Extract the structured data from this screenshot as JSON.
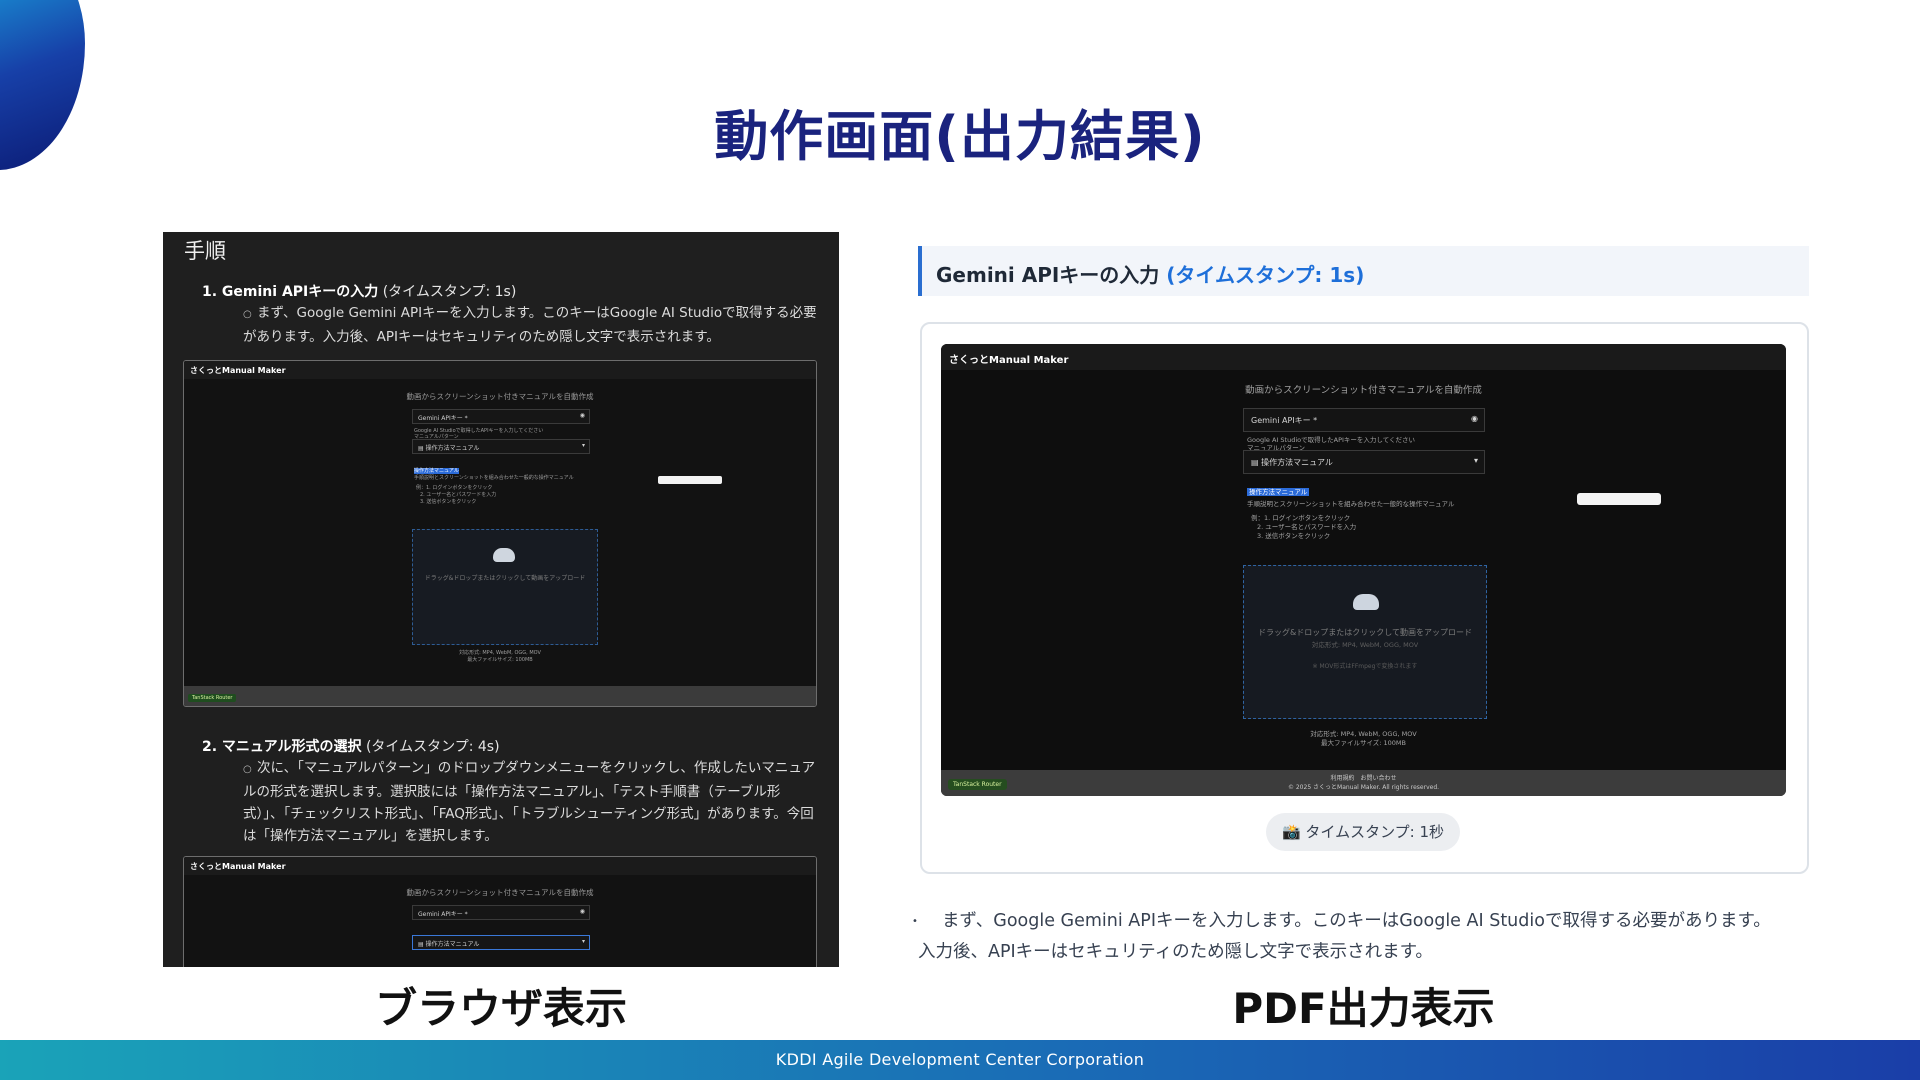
{
  "slide": {
    "title": "動作画面(出力結果)",
    "footer": "KDDI Agile Development Center Corporation",
    "caption_left": "ブラウザ表示",
    "caption_right": "PDF出力表示"
  },
  "browser_view": {
    "heading": "手順",
    "step1_title": "1. Gemini APIキーの入力",
    "step1_ts": " (タイムスタンプ: 1s)",
    "step1_desc": "まず、Google Gemini APIキーを入力します。このキーはGoogle AI Studioで取得する必要があります。入力後、APIキーはセキュリティのため隠し文字で表示されます。",
    "step2_title": "2. マニュアル形式の選択",
    "step2_ts": " (タイムスタンプ: 4s)",
    "step2_desc": "次に、「マニュアルパターン」のドロップダウンメニューをクリックし、作成したいマニュアルの形式を選択します。選択肢には「操作方法マニュアル」、「テスト手順書（テーブル形式）」、「チェックリスト形式」、「FAQ形式」、「トラブルシューティング形式」があります。今回は「操作方法マニュアル」を選択します。"
  },
  "embedded_app": {
    "app_name": "さくっとManual Maker",
    "subtitle": "動画からスクリーンショット付きマニュアルを自動作成",
    "api_key_label": "Gemini APIキー *",
    "api_key_hint": "Google AI Studioで取得したAPIキーを入力してください",
    "pattern_label": "マニュアルパターン",
    "pattern_value": "操作方法マニュアル",
    "pattern_desc_title": "操作方法マニュアル",
    "pattern_desc": "手順説明とスクリーンショットを組み合わせた一般的な操作マニュアル",
    "example_1": "例：1. ログインボタンをクリック",
    "example_2": "2. ユーザー名とパスワードを入力",
    "example_3": "3. 送信ボタンをクリック",
    "drop_text": "ドラッグ&ドロップまたはクリックして動画をアップロード",
    "drop_formats": "対応形式: MP4, WebM, OGG, MOV",
    "drop_ffmpeg": "※ MOV形式はFFmpegで変換されます",
    "formats_footer": "対応形式: MP4, WebM, OGG, MOV",
    "max_size": "最大ファイルサイズ: 100MB",
    "footer_links": "利用規約　お問い合わせ",
    "copyright": "© 2025 さくっとManual Maker. All rights reserved.",
    "badge": "TanStack Router"
  },
  "pdf_view": {
    "heading": "Gemini APIキーの入力",
    "heading_ts": "(タイムスタンプ: 1s)",
    "timestamp_chip": "📸 タイムスタンプ: 1秒",
    "body": "まず、Google Gemini APIキーを入力します。このキーはGoogle AI Studioで取得する必要があります。入力後、APIキーはセキュリティのため隠し文字で表示されます。"
  },
  "icons": [
    "eye-off-icon",
    "document-icon",
    "chevron-down-icon",
    "upload-cloud-icon",
    "camera-icon"
  ],
  "colors": {
    "title": "#1a237e",
    "accent": "#2a6ed0",
    "footer_start": "#1aa3b8",
    "footer_end": "#1a3ea8"
  }
}
